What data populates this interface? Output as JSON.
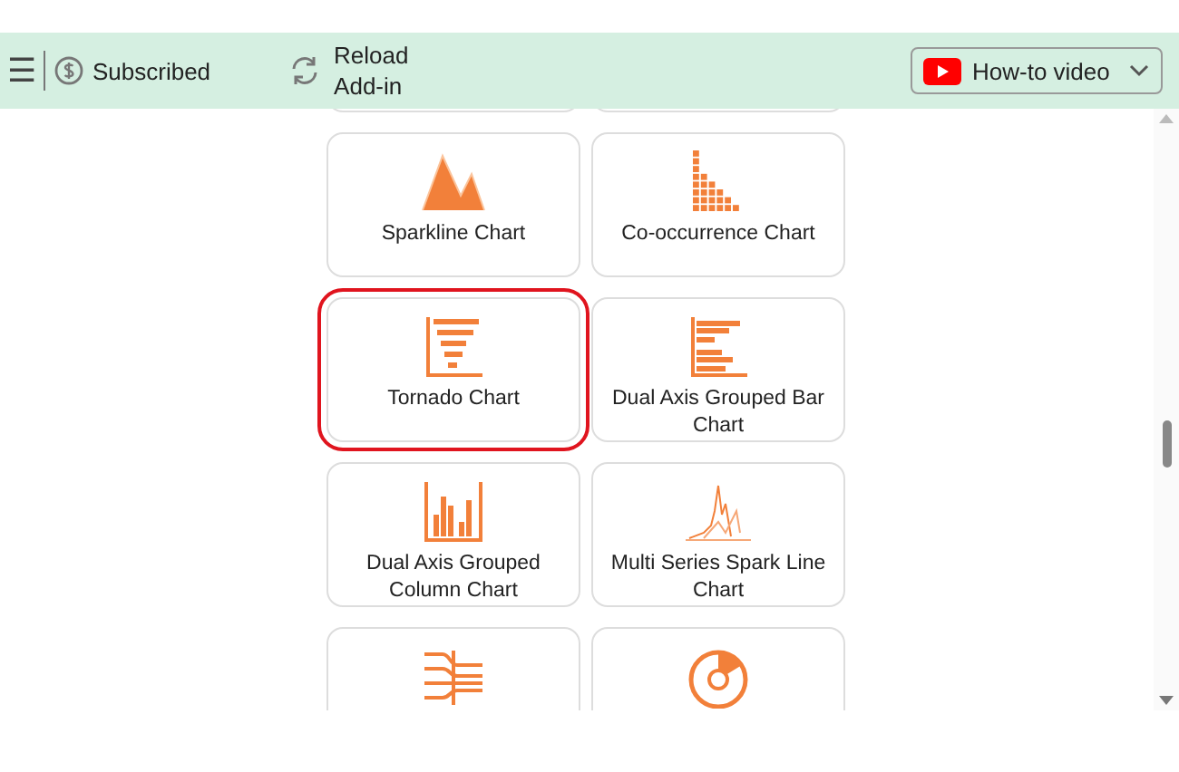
{
  "toolbar": {
    "menu_icon": "☰",
    "subscription": "Subscribed",
    "reload": "Reload Add-in",
    "video_dropdown": "How-to video"
  },
  "cards": [
    {
      "kind": "blank",
      "selected": false
    },
    {
      "kind": "blank",
      "selected": false
    },
    {
      "kind": "sparkline",
      "label": "Sparkline Chart",
      "selected": false
    },
    {
      "kind": "cooccurrence",
      "label": "Co-occurrence Chart",
      "selected": false
    },
    {
      "kind": "tornado",
      "label": "Tornado Chart",
      "selected": true
    },
    {
      "kind": "bar",
      "label": "Dual Axis Grouped Bar Chart",
      "selected": false
    },
    {
      "kind": "column",
      "label": "Dual Axis Grouped Column Chart",
      "selected": false
    },
    {
      "kind": "multispark",
      "label": "Multi Series Spark Line Chart",
      "selected": false
    },
    {
      "kind": "lines",
      "selected": false
    },
    {
      "kind": "radial",
      "selected": false
    }
  ]
}
